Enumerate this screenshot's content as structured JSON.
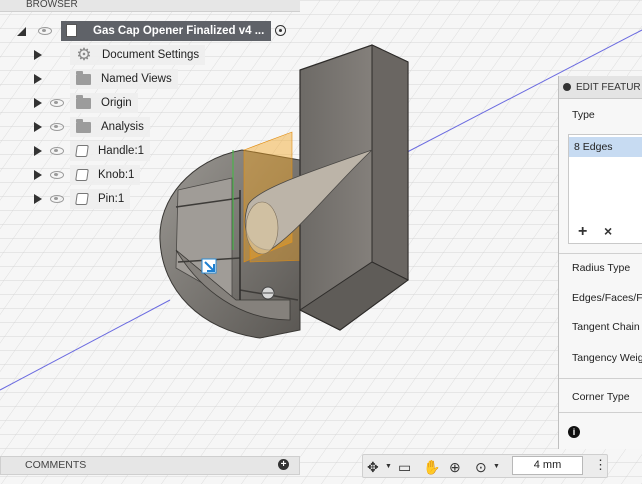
{
  "browser": {
    "title": "BROWSER",
    "root": {
      "label": "Gas Cap Opener Finalized v4 ..."
    },
    "items": [
      {
        "label": "Document Settings",
        "icon": "gear-icon",
        "has_eye": false
      },
      {
        "label": "Named Views",
        "icon": "folder-icon",
        "has_eye": false
      },
      {
        "label": "Origin",
        "icon": "folder-icon",
        "has_eye": true
      },
      {
        "label": "Analysis",
        "icon": "folder-icon",
        "has_eye": true
      },
      {
        "label": "Handle:1",
        "icon": "body-icon",
        "has_eye": true
      },
      {
        "label": "Knob:1",
        "icon": "body-icon",
        "has_eye": true
      },
      {
        "label": "Pin:1",
        "icon": "body-icon",
        "has_eye": true
      }
    ]
  },
  "edit_feature": {
    "title": "EDIT FEATUR",
    "type_label": "Type",
    "selection": "8 Edges",
    "add_symbol": "+",
    "remove_symbol": "×",
    "fields": [
      "Radius Type",
      "Edges/Faces/F",
      "Tangent Chain",
      "Tangency Weig"
    ],
    "corner_type_label": "Corner Type",
    "info_symbol": "i"
  },
  "comments": {
    "label": "COMMENTS",
    "plus_symbol": "+"
  },
  "nav_toolbar": {
    "icons": [
      "orbit-icon",
      "look-at-icon",
      "pan-hand-icon",
      "zoom-icon",
      "zoom-window-icon"
    ],
    "value": "4 mm",
    "more_symbol": "⋮"
  },
  "colors": {
    "grid": "#c8c8c8",
    "axis_blue": "#5a5ad6",
    "model_gray": "#8a8580",
    "selection_orange": "#f5a623",
    "header_dark": "#5f6268"
  }
}
